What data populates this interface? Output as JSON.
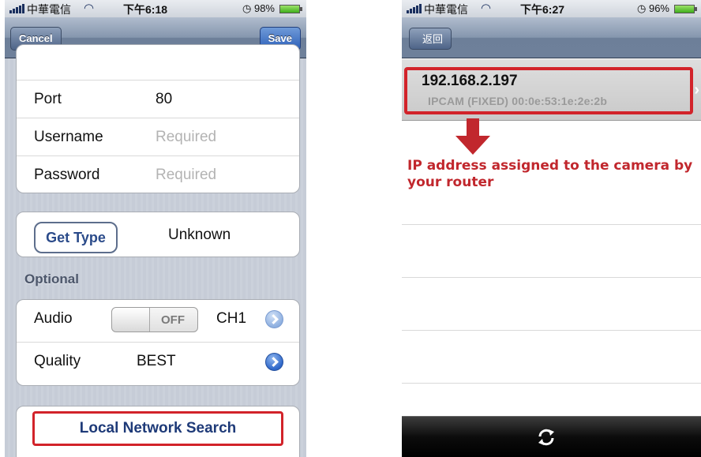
{
  "left": {
    "status": {
      "carrier": "中華電信",
      "time": "下午6:18",
      "battery": "98%"
    },
    "nav": {
      "cancel": "Cancel",
      "save": "Save"
    },
    "rows": {
      "port_label": "Port",
      "port_value": "80",
      "username_label": "Username",
      "username_placeholder": "Required",
      "password_label": "Password",
      "password_placeholder": "Required"
    },
    "get_type": {
      "button": "Get Type",
      "value": "Unknown"
    },
    "optional_header": "Optional",
    "audio": {
      "label": "Audio",
      "toggle": "OFF",
      "channel": "CH1"
    },
    "quality": {
      "label": "Quality",
      "value": "BEST"
    },
    "local_search": "Local Network Search"
  },
  "right": {
    "status": {
      "carrier": "中華電信",
      "time": "下午6:27",
      "battery": "96%"
    },
    "nav": {
      "back": "返回"
    },
    "device": {
      "ip": "192.168.2.197",
      "detail": "IPCAM (FIXED)  00:0e:53:1e:2e:2b"
    },
    "annotation": "IP address assigned to the camera by your router"
  },
  "colors": {
    "highlight": "#d2232a",
    "annotation": "#c1272d",
    "nav": "#6e809a"
  },
  "icons": {
    "wifi": "wifi-icon",
    "battery": "battery-icon",
    "refresh": "refresh-icon",
    "disclosure": "disclosure-icon"
  }
}
